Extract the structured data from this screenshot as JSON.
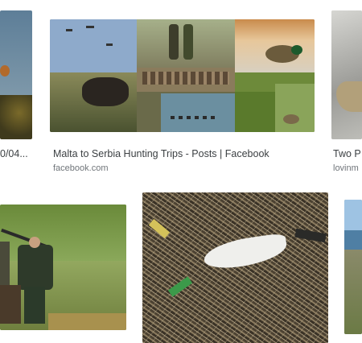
{
  "results": {
    "row1": [
      {
        "caption": "0/04...",
        "source": ""
      },
      {
        "caption": "Malta to Serbia Hunting Trips - Posts | Facebook",
        "source": "facebook.com"
      },
      {
        "caption": "Two P",
        "source": "lovinm"
      }
    ],
    "row2": [
      {
        "alt": "hunters walking with gear"
      },
      {
        "alt": "nest with shotgun shells and feather"
      },
      {
        "alt": "coastal cliff"
      }
    ]
  },
  "colors": {
    "caption_text": "#3c4043",
    "source_text": "#70757a"
  }
}
